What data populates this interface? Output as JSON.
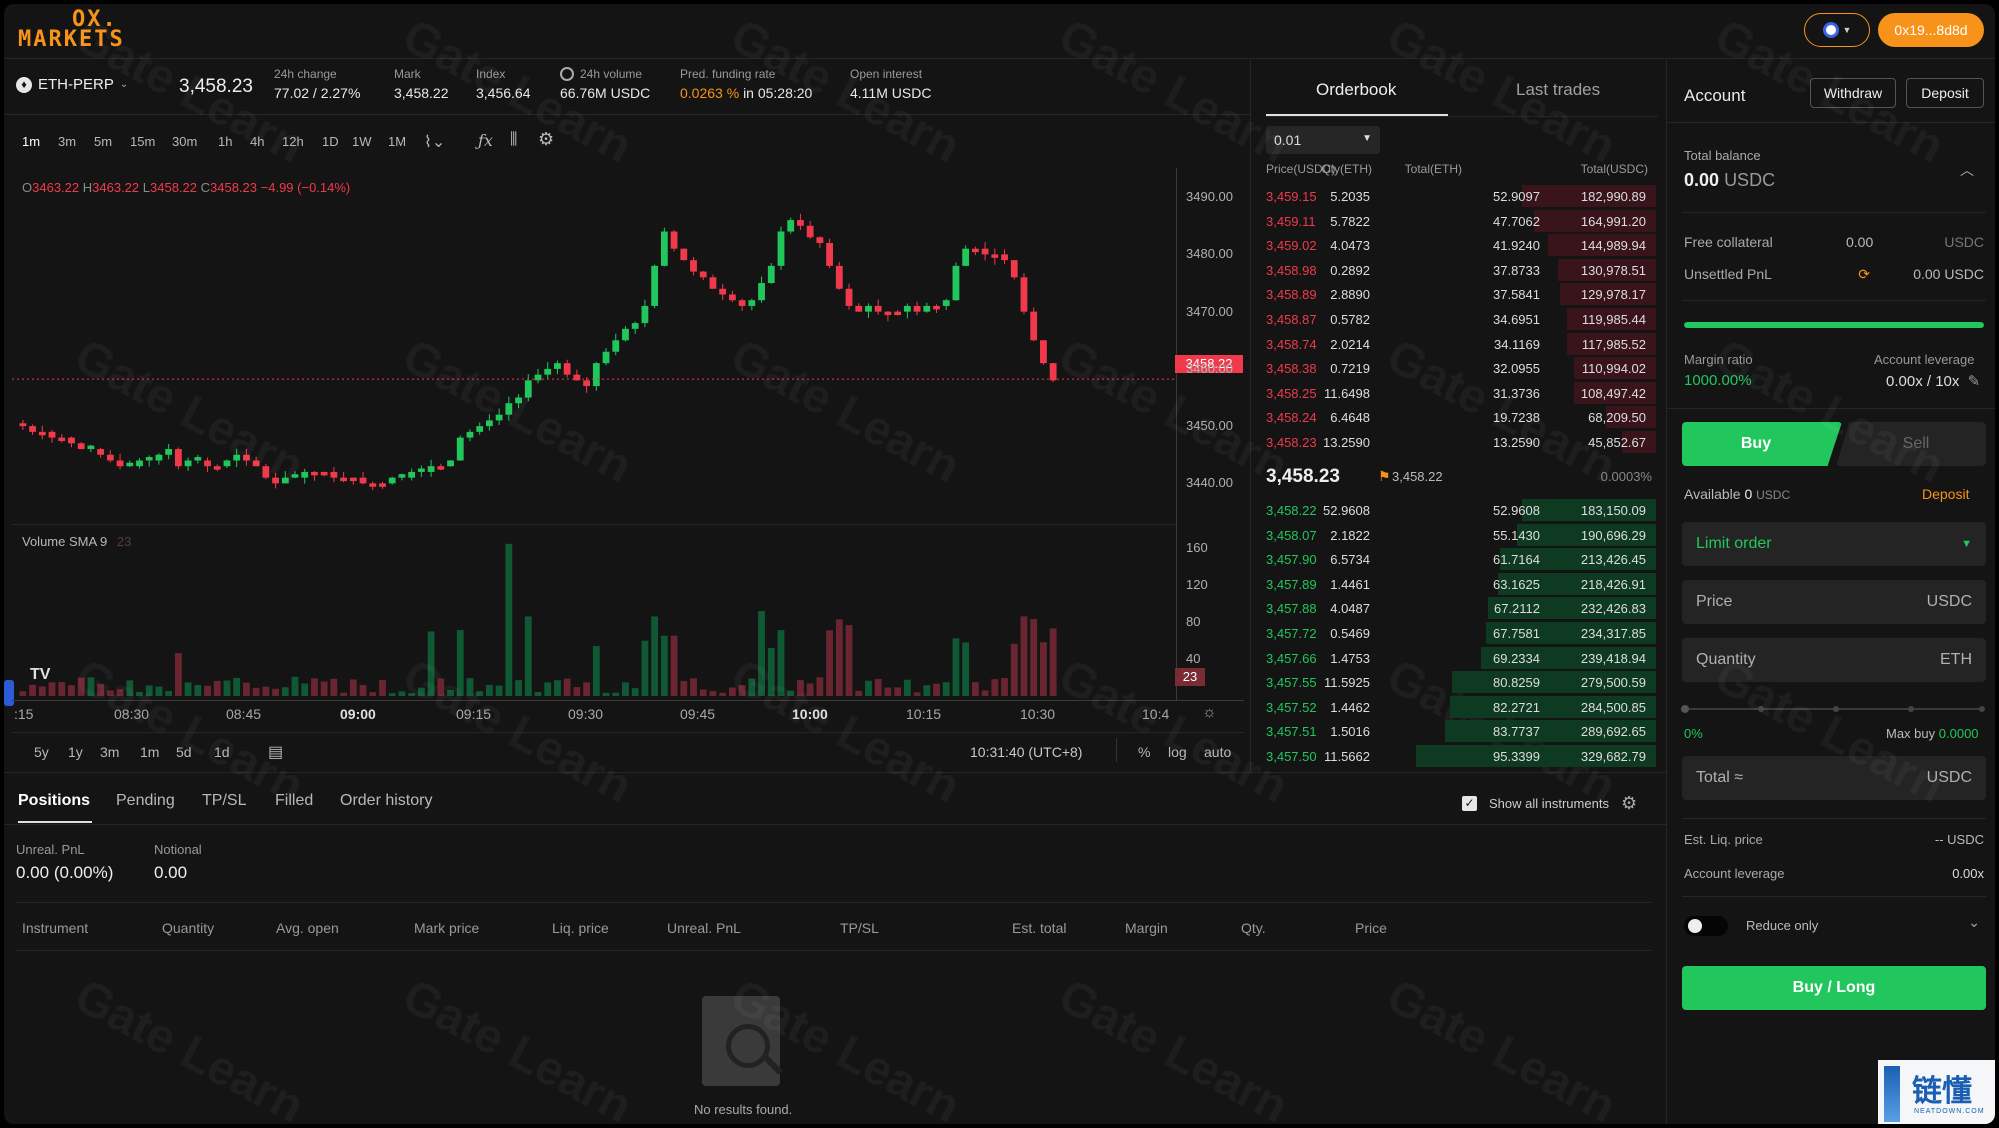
{
  "header": {
    "logo_line1": "OX.",
    "logo_line2": "MARKETS",
    "wallet_label": "0x19...8d8d"
  },
  "ticker": {
    "symbol": "ETH-PERP",
    "last_price": "3,458.23",
    "change_label": "24h change",
    "change_value": "77.02 / 2.27%",
    "mark_label": "Mark",
    "mark_value": "3,458.22",
    "index_label": "Index",
    "index_value": "3,456.64",
    "volume_label": "24h volume",
    "volume_value": "66.76M USDC",
    "funding_label": "Pred. funding rate",
    "funding_rate": "0.0263 %",
    "funding_in": "in 05:28:20",
    "oi_label": "Open interest",
    "oi_value": "4.11M USDC"
  },
  "toolbar": {
    "timeframes": [
      "1m",
      "3m",
      "5m",
      "15m",
      "30m",
      "1h",
      "4h",
      "12h",
      "1D",
      "1W",
      "1M"
    ]
  },
  "chart_data": {
    "type": "candlestick",
    "ohlc_legend": {
      "o": "3463.22",
      "h": "3463.22",
      "l": "3458.22",
      "c": "3458.23",
      "chg": "−4.99 (−0.14%)"
    },
    "price_ticks": [
      "3490.00",
      "3480.00",
      "3470.00",
      "3460.00",
      "3450.00",
      "3440.00"
    ],
    "ylim": [
      3435,
      3493
    ],
    "current_price_tag": "3458.22",
    "volume_study": "Volume SMA 9",
    "volume_study_value": "23",
    "volume_ticks": [
      "160",
      "120",
      "80",
      "40"
    ],
    "volume_tag": "23",
    "x_ticks": [
      ":15",
      "08:30",
      "08:45",
      "09:00",
      "09:15",
      "09:30",
      "09:45",
      "10:00",
      "10:15",
      "10:30",
      "10:4"
    ],
    "close_series": [
      3450,
      3449,
      3449,
      3448,
      3448,
      3447,
      3446,
      3446,
      3445,
      3444,
      3443,
      3443,
      3444,
      3444,
      3445,
      3446,
      3443,
      3444,
      3444,
      3443,
      3443,
      3444,
      3445,
      3444,
      3443,
      3441,
      3440,
      3441,
      3441,
      3442,
      3442,
      3442,
      3441,
      3441,
      3441,
      3440,
      3440,
      3440,
      3441,
      3441,
      3442,
      3442,
      3443,
      3443,
      3444,
      3448,
      3449,
      3450,
      3451,
      3452,
      3454,
      3455,
      3458,
      3459,
      3460,
      3461,
      3459,
      3458,
      3457,
      3461,
      3463,
      3465,
      3467,
      3468,
      3471,
      3478,
      3484,
      3481,
      3479,
      3477,
      3476,
      3474,
      3473,
      3472,
      3471,
      3472,
      3475,
      3478,
      3484,
      3486,
      3485,
      3483,
      3482,
      3478,
      3474,
      3471,
      3470,
      3471,
      3470,
      3470,
      3470,
      3471,
      3470,
      3471,
      3471,
      3472,
      3478,
      3481,
      3481,
      3480,
      3480,
      3479,
      3476,
      3470,
      3465,
      3461,
      3458
    ],
    "range_buttons": [
      "5y",
      "1y",
      "3m",
      "1m",
      "5d",
      "1d"
    ],
    "clock": "10:31:40 (UTC+8)",
    "scale_buttons": [
      "%",
      "log",
      "auto"
    ]
  },
  "orderbook": {
    "tabs": [
      "Orderbook",
      "Last trades"
    ],
    "tick_size": "0.01",
    "headers": [
      "Price(USDC)",
      "Qty(ETH)",
      "Total(ETH)",
      "Total(USDC)"
    ],
    "asks": [
      [
        "3,459.15",
        "5.2035",
        "52.9097",
        "182,990.89"
      ],
      [
        "3,459.11",
        "5.7822",
        "47.7062",
        "164,991.20"
      ],
      [
        "3,459.02",
        "4.0473",
        "41.9240",
        "144,989.94"
      ],
      [
        "3,458.98",
        "0.2892",
        "37.8733",
        "130,978.51"
      ],
      [
        "3,458.89",
        "2.8890",
        "37.5841",
        "129,978.17"
      ],
      [
        "3,458.87",
        "0.5782",
        "34.6951",
        "119,985.44"
      ],
      [
        "3,458.74",
        "2.0214",
        "34.1169",
        "117,985.52"
      ],
      [
        "3,458.38",
        "0.7219",
        "32.0955",
        "110,994.02"
      ],
      [
        "3,458.25",
        "11.6498",
        "31.3736",
        "108,497.42"
      ],
      [
        "3,458.24",
        "6.4648",
        "19.7238",
        "68,209.50"
      ],
      [
        "3,458.23",
        "13.2590",
        "13.2590",
        "45,852.67"
      ]
    ],
    "ask_depth": [
      0.56,
      0.51,
      0.45,
      0.41,
      0.4,
      0.37,
      0.37,
      0.34,
      0.34,
      0.21,
      0.14
    ],
    "mid_price": "3,458.23",
    "mid_mark": "3,458.22",
    "spread": "0.0003%",
    "bids": [
      [
        "3,458.22",
        "52.9608",
        "52.9608",
        "183,150.09"
      ],
      [
        "3,458.07",
        "2.1822",
        "55.1430",
        "190,696.29"
      ],
      [
        "3,457.90",
        "6.5734",
        "61.7164",
        "213,426.45"
      ],
      [
        "3,457.89",
        "1.4461",
        "63.1625",
        "218,426.91"
      ],
      [
        "3,457.88",
        "4.0487",
        "67.2112",
        "232,426.83"
      ],
      [
        "3,457.72",
        "0.5469",
        "67.7581",
        "234,317.85"
      ],
      [
        "3,457.66",
        "1.4753",
        "69.2334",
        "239,418.94"
      ],
      [
        "3,457.55",
        "11.5925",
        "80.8259",
        "279,500.59"
      ],
      [
        "3,457.52",
        "1.4462",
        "82.2721",
        "284,500.85"
      ],
      [
        "3,457.51",
        "1.5016",
        "83.7737",
        "289,692.65"
      ],
      [
        "3,457.50",
        "11.5662",
        "95.3399",
        "329,682.79"
      ]
    ],
    "bid_depth": [
      0.56,
      0.58,
      0.65,
      0.66,
      0.7,
      0.71,
      0.73,
      0.85,
      0.86,
      0.88,
      1.0
    ]
  },
  "positions": {
    "tabs": [
      "Positions",
      "Pending",
      "TP/SL",
      "Filled",
      "Order history"
    ],
    "show_all_label": "Show all instruments",
    "unreal_label": "Unreal. PnL",
    "unreal_value": "0.00",
    "unreal_pct": "(0.00%)",
    "notional_label": "Notional",
    "notional_value": "0.00",
    "columns": [
      "Instrument",
      "Quantity",
      "Avg. open",
      "Mark price",
      "Liq. price",
      "Unreal. PnL",
      "TP/SL",
      "Est. total",
      "Margin",
      "Qty.",
      "Price"
    ],
    "empty_text": "No results found."
  },
  "account": {
    "title": "Account",
    "withdraw": "Withdraw",
    "deposit": "Deposit",
    "total_balance_label": "Total balance",
    "total_balance_value": "0.00",
    "total_balance_unit": "USDC",
    "free_collateral_label": "Free collateral",
    "free_collateral_value": "0.00",
    "free_collateral_unit": "USDC",
    "unsettled_label": "Unsettled PnL",
    "unsettled_value": "0.00 USDC",
    "margin_ratio_label": "Margin ratio",
    "margin_ratio_value": "1000.00%",
    "margin_ratio_fill": 1.0,
    "leverage_label": "Account leverage",
    "leverage_value": "0.00x / 10x"
  },
  "order_form": {
    "buy_tab": "Buy",
    "sell_tab": "Sell",
    "available_label": "Available",
    "available_value": "0",
    "available_unit": "USDC",
    "deposit_link": "Deposit",
    "order_type": "Limit order",
    "price_label": "Price",
    "price_unit": "USDC",
    "quantity_label": "Quantity",
    "quantity_unit": "ETH",
    "slider_pct": "0%",
    "max_buy_label": "Max buy",
    "max_buy_value": "0.0000",
    "total_label": "Total ≈",
    "total_unit": "USDC",
    "est_liq_label": "Est. Liq. price",
    "est_liq_value": "-- USDC",
    "acct_lev_label": "Account leverage",
    "acct_lev_value": "0.00x",
    "reduce_only_label": "Reduce only",
    "submit_label": "Buy / Long"
  },
  "watermark": {
    "text": "Gate Learn",
    "corner_logo": "链懂",
    "corner_sub": "NEATDOWN.COM"
  },
  "colors": {
    "up": "#21c75c",
    "down": "#f03a4b",
    "accent": "#f7931a",
    "panel": "#141414"
  }
}
